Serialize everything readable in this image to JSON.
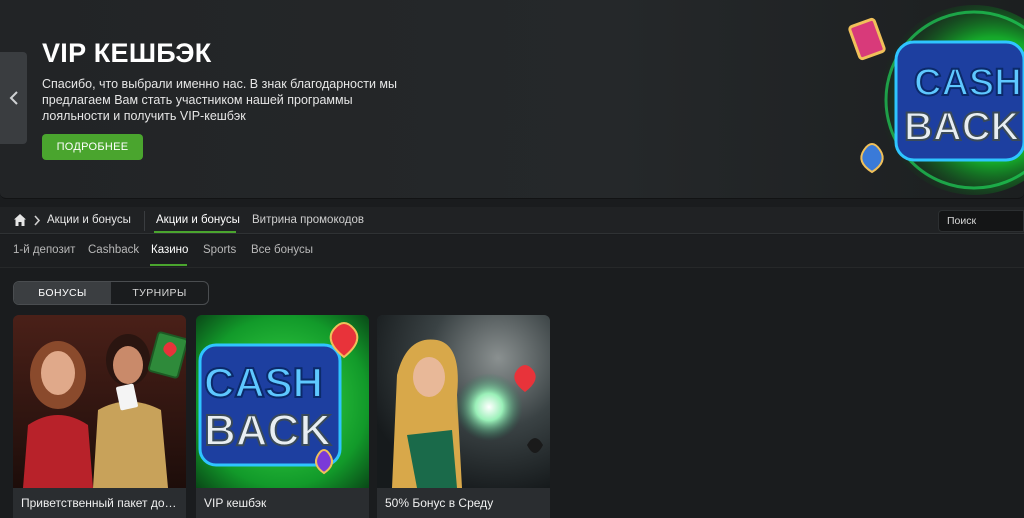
{
  "hero": {
    "title": "VIP КЕШБЭК",
    "text": "Спасибо, что выбрали именно нас. В знак благодарности мы предлагаем Вам стать участником нашей программы лояльности и получить VIP-кешбэк",
    "button_label": "ПОДРОБНЕЕ",
    "art_text_line1": "CASH",
    "art_text_line2": "BACK",
    "prev_icon": "chevron-left-icon"
  },
  "breadcrumb": {
    "home_icon": "home-icon",
    "label": "Акции и бонусы"
  },
  "nav": {
    "tabs": [
      {
        "label": "Акции и бонусы",
        "active": true
      },
      {
        "label": "Витрина промокодов",
        "active": false
      }
    ],
    "search_placeholder": "Поиск"
  },
  "subtabs": [
    {
      "label": "1-й депозит",
      "active": false
    },
    {
      "label": "Cashback",
      "active": false
    },
    {
      "label": "Казино",
      "active": true
    },
    {
      "label": "Sports",
      "active": false
    },
    {
      "label": "Все бонусы",
      "active": false
    }
  ],
  "toggle": {
    "options": [
      {
        "label": "БОНУСЫ",
        "active": true
      },
      {
        "label": "ТУРНИРЫ",
        "active": false
      }
    ]
  },
  "cards": [
    {
      "title": "Приветственный пакет до…"
    },
    {
      "title": "VIP кешбэк",
      "art_line1": "CASH",
      "art_line2": "BACK"
    },
    {
      "title": "50% Бонус в Среду"
    }
  ],
  "colors": {
    "accent": "#4aa52e",
    "background": "#1a1c1e",
    "card_bg": "#2a2d30"
  }
}
